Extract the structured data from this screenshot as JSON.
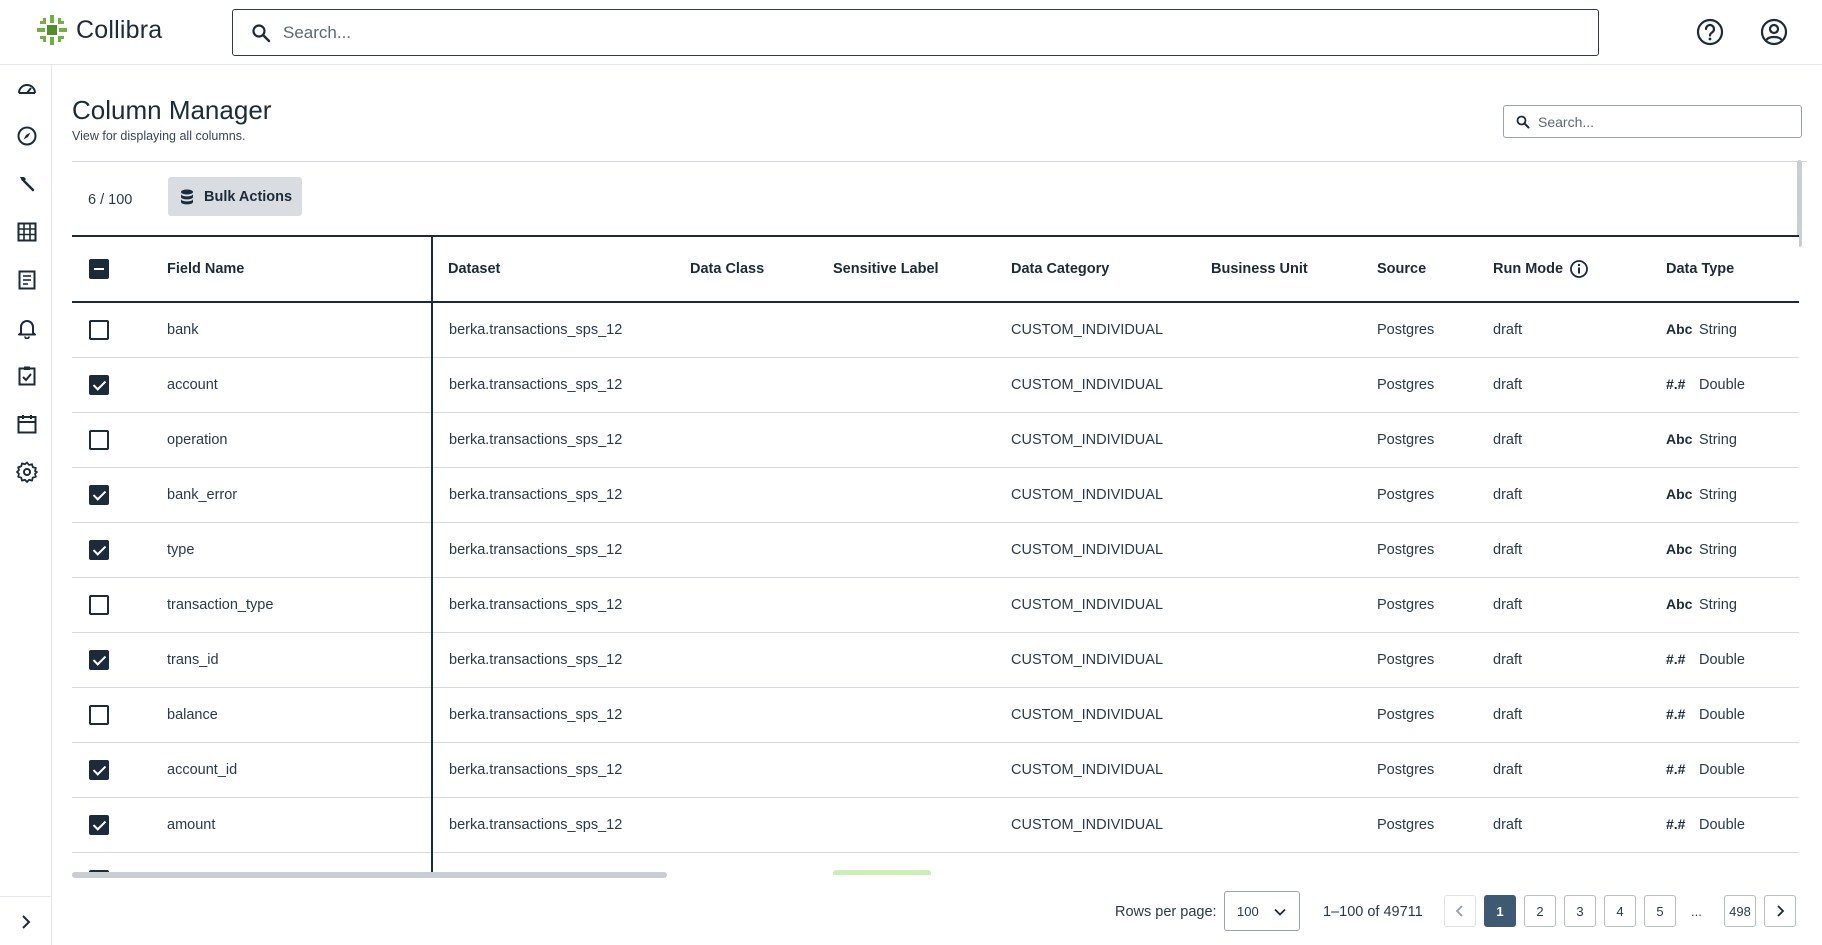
{
  "app": {
    "brand": "Collibra"
  },
  "header": {
    "search_placeholder": "Search...",
    "icons": [
      "help-icon",
      "account-icon"
    ]
  },
  "nav": {
    "icons": [
      "dashboard-icon",
      "explore-icon",
      "tools-icon",
      "catalog-icon",
      "reports-icon",
      "alerts-icon",
      "tasks-icon",
      "calendar-icon",
      "settings-icon"
    ],
    "expand_icon": "chevron-right-icon"
  },
  "page": {
    "title": "Column Manager",
    "subtitle": "View for displaying all columns.",
    "search_placeholder": "Search..."
  },
  "toolbar": {
    "selection_count": "6 / 100",
    "bulk_actions_label": "Bulk Actions"
  },
  "table": {
    "headers": {
      "field_name": "Field Name",
      "dataset": "Dataset",
      "data_class": "Data Class",
      "sensitive_label": "Sensitive Label",
      "data_category": "Data Category",
      "business_unit": "Business Unit",
      "source": "Source",
      "run_mode": "Run Mode",
      "data_type": "Data Type"
    },
    "rows": [
      {
        "checked": false,
        "field": "bank",
        "dataset": "berka.transactions_sps_12",
        "category": "CUSTOM_INDIVIDUAL",
        "source": "Postgres",
        "run_mode": "draft",
        "type_icon": "Abc",
        "type": "String"
      },
      {
        "checked": true,
        "field": "account",
        "dataset": "berka.transactions_sps_12",
        "category": "CUSTOM_INDIVIDUAL",
        "source": "Postgres",
        "run_mode": "draft",
        "type_icon": "#.#",
        "type": "Double"
      },
      {
        "checked": false,
        "field": "operation",
        "dataset": "berka.transactions_sps_12",
        "category": "CUSTOM_INDIVIDUAL",
        "source": "Postgres",
        "run_mode": "draft",
        "type_icon": "Abc",
        "type": "String"
      },
      {
        "checked": true,
        "field": "bank_error",
        "dataset": "berka.transactions_sps_12",
        "category": "CUSTOM_INDIVIDUAL",
        "source": "Postgres",
        "run_mode": "draft",
        "type_icon": "Abc",
        "type": "String"
      },
      {
        "checked": true,
        "field": "type",
        "dataset": "berka.transactions_sps_12",
        "category": "CUSTOM_INDIVIDUAL",
        "source": "Postgres",
        "run_mode": "draft",
        "type_icon": "Abc",
        "type": "String"
      },
      {
        "checked": false,
        "field": "transaction_type",
        "dataset": "berka.transactions_sps_12",
        "category": "CUSTOM_INDIVIDUAL",
        "source": "Postgres",
        "run_mode": "draft",
        "type_icon": "Abc",
        "type": "String"
      },
      {
        "checked": true,
        "field": "trans_id",
        "dataset": "berka.transactions_sps_12",
        "category": "CUSTOM_INDIVIDUAL",
        "source": "Postgres",
        "run_mode": "draft",
        "type_icon": "#.#",
        "type": "Double"
      },
      {
        "checked": false,
        "field": "balance",
        "dataset": "berka.transactions_sps_12",
        "category": "CUSTOM_INDIVIDUAL",
        "source": "Postgres",
        "run_mode": "draft",
        "type_icon": "#.#",
        "type": "Double"
      },
      {
        "checked": true,
        "field": "account_id",
        "dataset": "berka.transactions_sps_12",
        "category": "CUSTOM_INDIVIDUAL",
        "source": "Postgres",
        "run_mode": "draft",
        "type_icon": "#.#",
        "type": "Double"
      },
      {
        "checked": true,
        "field": "amount",
        "dataset": "berka.transactions_sps_12",
        "category": "CUSTOM_INDIVIDUAL",
        "source": "Postgres",
        "run_mode": "draft",
        "type_icon": "#.#",
        "type": "Double"
      }
    ]
  },
  "pagination": {
    "rows_per_page_label": "Rows per page:",
    "rows_per_page_value": "100",
    "range": "1–100 of 49711",
    "pages": [
      "1",
      "2",
      "3",
      "4",
      "5"
    ],
    "ellipsis": "...",
    "last_page": "498",
    "active_page": "1"
  }
}
